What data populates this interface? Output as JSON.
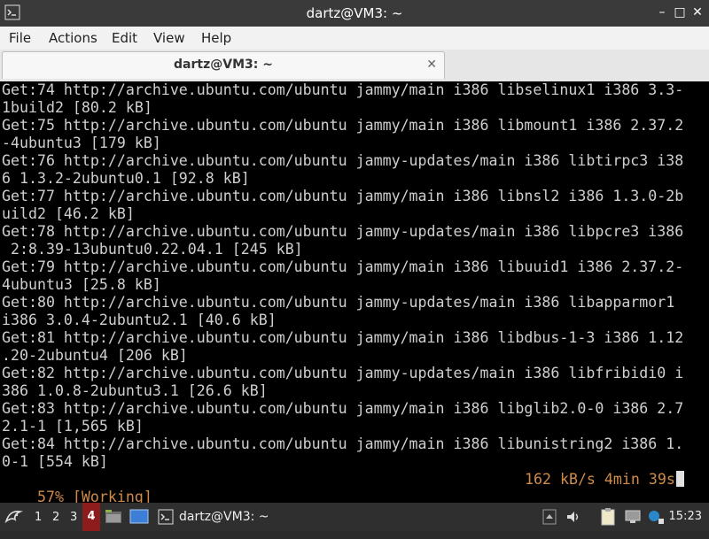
{
  "window": {
    "title": "dartz@VM3: ~"
  },
  "window_controls": {
    "minimize": "–",
    "maximize": "□",
    "close": "✕"
  },
  "menubar": {
    "items": [
      "File",
      "Actions",
      "Edit",
      "View",
      "Help"
    ]
  },
  "tab": {
    "label": "dartz@VM3: ~",
    "close": "✕"
  },
  "terminal": {
    "lines": [
      "Get:74 http://archive.ubuntu.com/ubuntu jammy/main i386 libselinux1 i386 3.3-",
      "1build2 [80.2 kB]",
      "Get:75 http://archive.ubuntu.com/ubuntu jammy/main i386 libmount1 i386 2.37.2",
      "-4ubuntu3 [179 kB]",
      "Get:76 http://archive.ubuntu.com/ubuntu jammy-updates/main i386 libtirpc3 i38",
      "6 1.3.2-2ubuntu0.1 [92.8 kB]",
      "Get:77 http://archive.ubuntu.com/ubuntu jammy/main i386 libnsl2 i386 1.3.0-2b",
      "uild2 [46.2 kB]",
      "Get:78 http://archive.ubuntu.com/ubuntu jammy-updates/main i386 libpcre3 i386",
      " 2:8.39-13ubuntu0.22.04.1 [245 kB]",
      "Get:79 http://archive.ubuntu.com/ubuntu jammy/main i386 libuuid1 i386 2.37.2-",
      "4ubuntu3 [25.8 kB]",
      "Get:80 http://archive.ubuntu.com/ubuntu jammy-updates/main i386 libapparmor1",
      "i386 3.0.4-2ubuntu2.1 [40.6 kB]",
      "Get:81 http://archive.ubuntu.com/ubuntu jammy/main i386 libdbus-1-3 i386 1.12",
      ".20-2ubuntu4 [206 kB]",
      "Get:82 http://archive.ubuntu.com/ubuntu jammy-updates/main i386 libfribidi0 i",
      "386 1.0.8-2ubuntu3.1 [26.6 kB]",
      "Get:83 http://archive.ubuntu.com/ubuntu jammy/main i386 libglib2.0-0 i386 2.7",
      "2.1-1 [1,565 kB]",
      "Get:84 http://archive.ubuntu.com/ubuntu jammy/main i386 libunistring2 i386 1.",
      "0-1 [554 kB]"
    ],
    "status_left": "57% [Working]",
    "status_right": "162 kB/s 4min 39s",
    "status_color": "#d08b4a"
  },
  "taskbar": {
    "workspaces": [
      "1",
      "2",
      "3",
      "4"
    ],
    "active_workspace": "4",
    "task_label": "dartz@VM3: ~",
    "clock": "15:23",
    "icons": [
      "start-menu-icon",
      "file-manager-icon",
      "desktop-icon",
      "terminal-icon",
      "show-hidden-icon",
      "volume-icon",
      "clipboard-icon",
      "network-icon",
      "update-notifier-icon"
    ]
  }
}
